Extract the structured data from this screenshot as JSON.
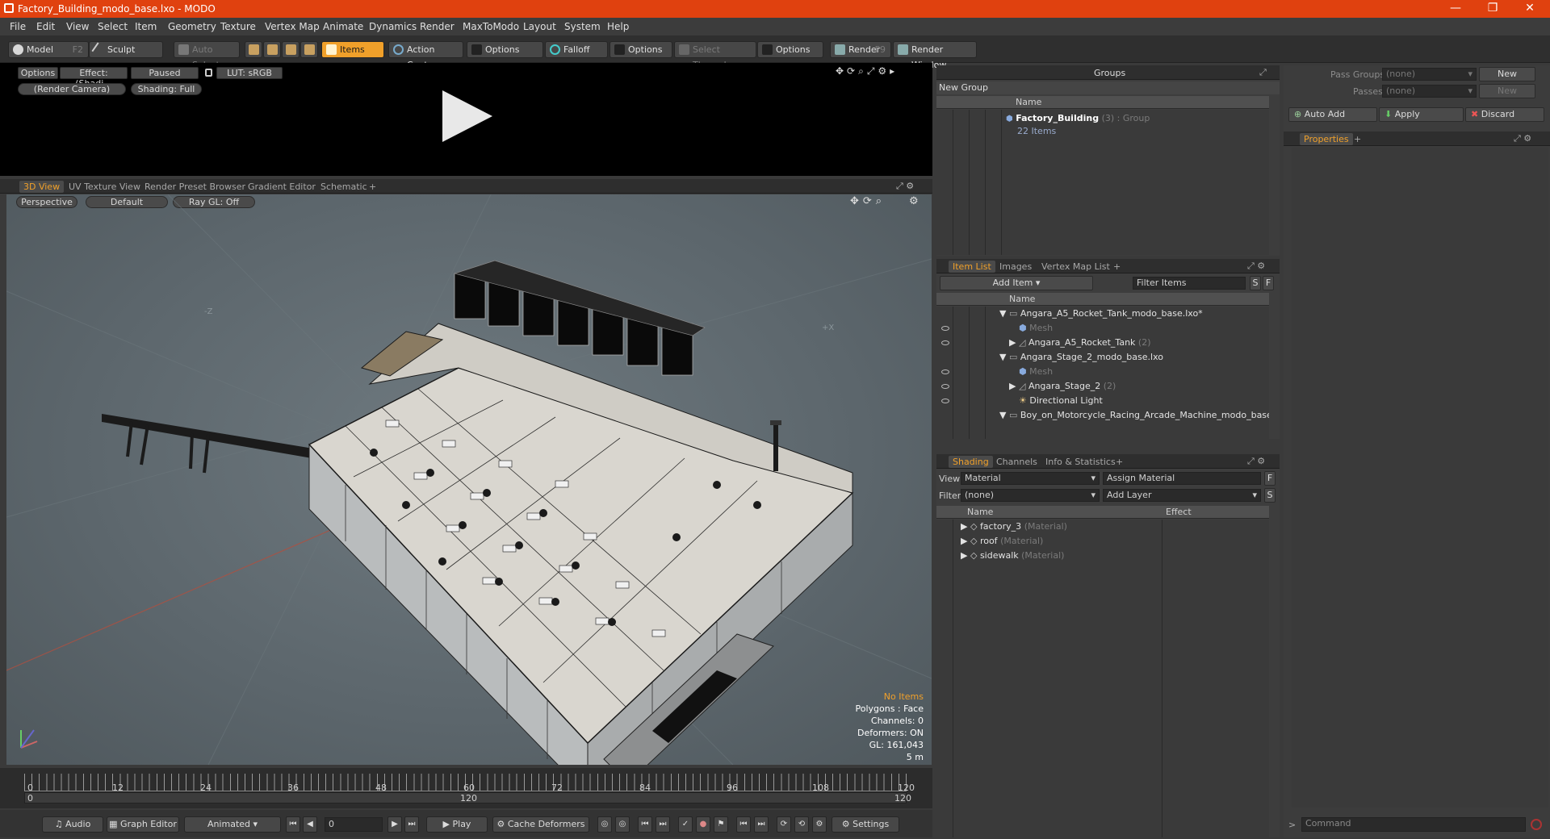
{
  "window": {
    "title": "Factory_Building_modo_base.lxo - MODO",
    "minimize": "—",
    "maximize": "❐",
    "close": "✕"
  },
  "menu": [
    "File",
    "Edit",
    "View",
    "Select",
    "Item",
    "Geometry",
    "Texture",
    "Vertex Map",
    "Animate",
    "Dynamics",
    "Render",
    "MaxToModo",
    "Layout",
    "System",
    "Help"
  ],
  "toolbar": {
    "model": "Model",
    "model_key": "F2",
    "sculpt": "Sculpt",
    "auto_select": "Auto Select",
    "items": "Items",
    "action_center": "Action Center",
    "options1": "Options",
    "falloff": "Falloff",
    "options2": "Options",
    "select_through": "Select Through",
    "options3": "Options",
    "render": "Render",
    "render_key": "F9",
    "render_window": "Render Window"
  },
  "preview": {
    "options": "Options",
    "effect": "Effect: (Shadi...",
    "paused": "Paused",
    "lut": "LUT: sRGB",
    "camera": "(Render Camera)",
    "shading": "Shading: Full"
  },
  "viewport_tabs": [
    "3D View",
    "UV Texture View",
    "Render Preset Browser",
    "Gradient Editor",
    "Schematic",
    "+"
  ],
  "viewport": {
    "perspective": "Perspective",
    "default": "Default",
    "raygl": "Ray GL: Off",
    "axis_z": "-Z",
    "axis_x": "+X",
    "status": [
      "No Items",
      "Polygons : Face",
      "Channels: 0",
      "Deformers: ON",
      "GL: 161,043",
      "5 m"
    ]
  },
  "timeline": {
    "ticks": [
      "0",
      "12",
      "24",
      "36",
      "48",
      "60",
      "72",
      "84",
      "96",
      "108",
      "120"
    ],
    "sub_ticks": [
      "0",
      "120",
      "120"
    ]
  },
  "bottombar": {
    "audio": "Audio",
    "graph_editor": "Graph Editor",
    "animated": "Animated",
    "frame": "0",
    "play": "Play",
    "cache_deformers": "Cache Deformers",
    "settings": "Settings"
  },
  "groups": {
    "title": "Groups",
    "new_group": "New Group",
    "name_col": "Name",
    "item_name": "Factory_Building",
    "item_count": "(3)",
    "item_type": ": Group",
    "item_sub": "22 Items"
  },
  "item_list": {
    "tabs": [
      "Item List",
      "Images",
      "Vertex Map List",
      "+"
    ],
    "add_item": "Add Item",
    "filter": "Filter Items",
    "s": "S",
    "f": "F",
    "name_col": "Name",
    "rows": [
      {
        "label": "Angara_A5_Rocket_Tank_modo_base.lxo*",
        "extra": "",
        "dim": false
      },
      {
        "label": "Mesh",
        "extra": "",
        "dim": true
      },
      {
        "label": "Angara_A5_Rocket_Tank",
        "extra": "(2)",
        "dim": false
      },
      {
        "label": "Angara_Stage_2_modo_base.lxo",
        "extra": "",
        "dim": false
      },
      {
        "label": "Mesh",
        "extra": "",
        "dim": true
      },
      {
        "label": "Angara_Stage_2",
        "extra": "(2)",
        "dim": false
      },
      {
        "label": "Directional Light",
        "extra": "",
        "dim": false
      },
      {
        "label": "Boy_on_Motorcycle_Racing_Arcade_Machine_modo_base....",
        "extra": "",
        "dim": false
      }
    ]
  },
  "shading": {
    "tabs": [
      "Shading",
      "Channels",
      "Info & Statistics",
      "+"
    ],
    "view_label": "View",
    "view_value": "Material",
    "assign": "Assign Material",
    "f": "F",
    "filter_label": "Filter",
    "filter_value": "(none)",
    "add_layer": "Add Layer",
    "s": "S",
    "name_col": "Name",
    "effect_col": "Effect",
    "rows": [
      {
        "label": "factory_3",
        "type": "(Material)"
      },
      {
        "label": "roof",
        "type": "(Material)"
      },
      {
        "label": "sidewalk",
        "type": "(Material)"
      }
    ]
  },
  "right_panel": {
    "pass_groups": "Pass Groups",
    "pass_groups_val": "(none)",
    "new": "New",
    "passes": "Passes",
    "passes_val": "(none)",
    "new2": "New",
    "auto_add": "Auto Add",
    "apply": "Apply",
    "discard": "Discard",
    "properties": "Properties",
    "plus": "+",
    "command": "Command"
  }
}
